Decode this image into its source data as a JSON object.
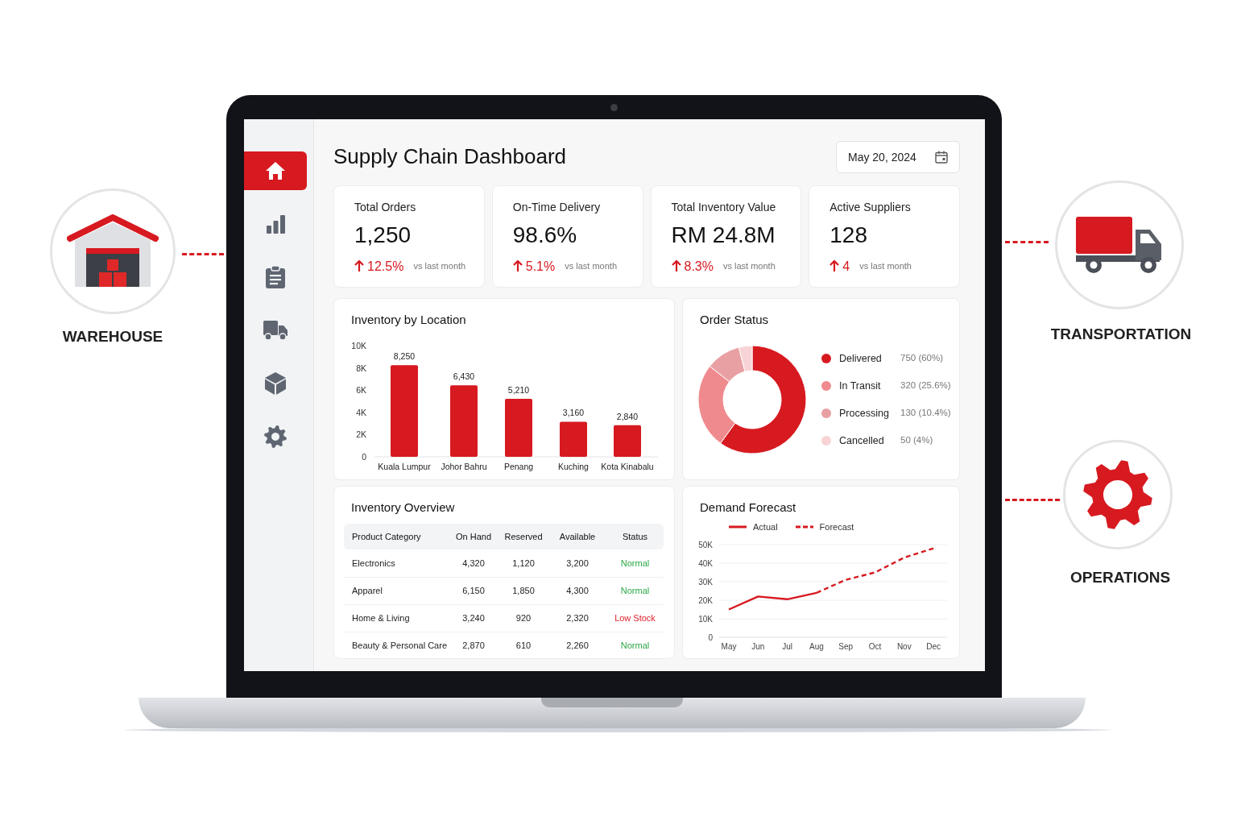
{
  "callouts": [
    {
      "label": "WAREHOUSE"
    },
    {
      "label": "TRANSPORTATION"
    },
    {
      "label": "OPERATIONS"
    }
  ],
  "sidebar": {
    "items": [
      {
        "selected": true
      },
      {
        "selected": false
      },
      {
        "selected": false
      },
      {
        "selected": false
      },
      {
        "selected": false
      },
      {
        "selected": false
      }
    ]
  },
  "header": {
    "title": "Supply Chain Dashboard",
    "date": "May 20, 2024"
  },
  "kpis": [
    {
      "label": "Total Orders",
      "value": "1,250",
      "change": "12.5%",
      "note": "vs last month"
    },
    {
      "label": "On-Time Delivery",
      "value": "98.6%",
      "change": "5.1%",
      "note": "vs last month"
    },
    {
      "label": "Total Inventory Value",
      "value": "RM 24.8M",
      "change": "8.3%",
      "note": "vs last month"
    },
    {
      "label": "Active Suppliers",
      "value": "128",
      "change": "4",
      "note": "vs last month"
    }
  ],
  "inventory_by_location": {
    "title": "Inventory by Location",
    "chart_data": {
      "type": "bar",
      "categories": [
        "Kuala Lumpur",
        "Johor Bahru",
        "Penang",
        "Kuching",
        "Kota Kinabalu"
      ],
      "values": [
        8250,
        6430,
        5210,
        3160,
        2840
      ],
      "value_labels": [
        "8,250",
        "6,430",
        "5,210",
        "3,160",
        "2,840"
      ],
      "ylim": [
        0,
        10000
      ],
      "yticks": [
        {
          "value": 0,
          "label": "0"
        },
        {
          "value": 2000,
          "label": "2K"
        },
        {
          "value": 4000,
          "label": "4K"
        },
        {
          "value": 6000,
          "label": "6K"
        },
        {
          "value": 8000,
          "label": "8K"
        },
        {
          "value": 10000,
          "label": "10K"
        }
      ],
      "data_labels": true,
      "grid": false
    }
  },
  "order_status": {
    "title": "Order Status",
    "chart_data": {
      "type": "donut",
      "categories": [
        "Delivered",
        "In Transit",
        "Processing",
        "Cancelled"
      ],
      "values": [
        60,
        25.6,
        10.4,
        4
      ]
    },
    "legend": [
      {
        "reading": "750 (60%)",
        "color": "#d71920"
      },
      {
        "reading": "320 (25.6%)",
        "color": "#ef8a8e"
      },
      {
        "reading": "130 (10.4%)",
        "color": "#e8a0a3"
      },
      {
        "reading": "50 (4%)",
        "color": "#f8d3d5"
      }
    ]
  },
  "inventory_overview": {
    "title": "Inventory Overview",
    "columns": [
      "Product Category",
      "On Hand",
      "Reserved",
      "Available",
      "Status"
    ],
    "rows": [
      {
        "cells": [
          "Electronics",
          "4,320",
          "1,120",
          "3,200"
        ],
        "status": "Normal",
        "alert": false
      },
      {
        "cells": [
          "Apparel",
          "6,150",
          "1,850",
          "4,300"
        ],
        "status": "Normal",
        "alert": false
      },
      {
        "cells": [
          "Home & Living",
          "3,240",
          "920",
          "2,320"
        ],
        "status": "Low Stock",
        "alert": true
      },
      {
        "cells": [
          "Beauty & Personal Care",
          "2,870",
          "610",
          "2,260"
        ],
        "status": "Normal",
        "alert": false
      }
    ]
  },
  "demand_forecast": {
    "title": "Demand Forecast",
    "chart_data": {
      "type": "line",
      "categories": [
        "May",
        "Jun",
        "Jul",
        "Aug",
        "Sep",
        "Oct",
        "Nov",
        "Dec"
      ],
      "series": [
        {
          "name": "Actual",
          "color": "#d71920",
          "line_style": "solid",
          "values": [
            15000,
            22000,
            20500,
            24000,
            null,
            null,
            null,
            null
          ]
        },
        {
          "name": "Forecast",
          "color": "#d71920",
          "line_style": "dashed",
          "values": [
            null,
            null,
            null,
            24000,
            31000,
            35000,
            43000,
            48000
          ]
        }
      ],
      "grid": true,
      "legend": true,
      "ylim": [
        0,
        50000
      ],
      "yticks": [
        {
          "value": 0,
          "label": "0"
        },
        {
          "value": 10000,
          "label": "10K"
        },
        {
          "value": 20000,
          "label": "20K"
        },
        {
          "value": 30000,
          "label": "30K"
        },
        {
          "value": 40000,
          "label": "40K"
        },
        {
          "value": 50000,
          "label": "50K"
        }
      ]
    }
  }
}
